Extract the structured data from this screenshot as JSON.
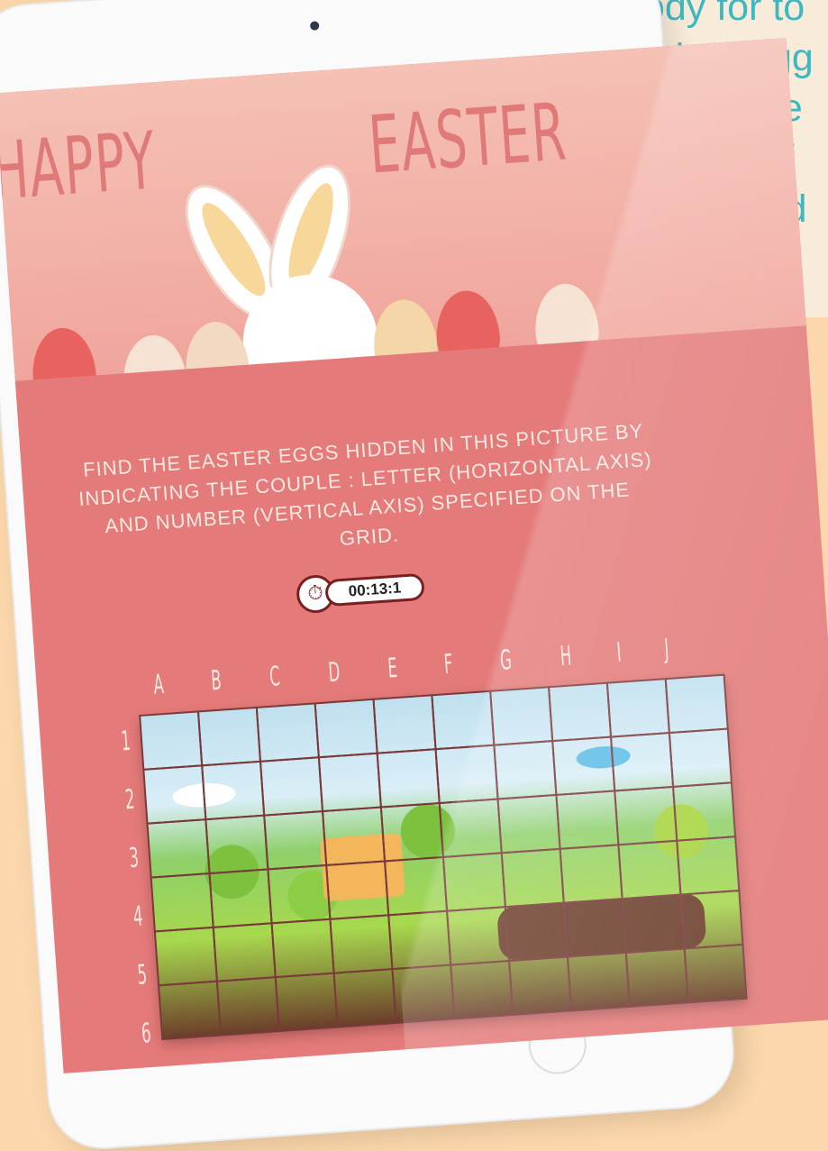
{
  "side_text": {
    "lines": "body for to\nfind an egg\nthe picture\namount of\nyour brand"
  },
  "game": {
    "title_left": "HAPPY",
    "title_right": "EASTER",
    "instructions": "Find the Easter eggs hidden in this picture by indicating the couple : letter (horizontal axis) and number (vertical axis) specified on the grid.",
    "timer_value": "00:13:1",
    "timer_icon": "stopwatch-icon",
    "columns": [
      "A",
      "B",
      "C",
      "D",
      "E",
      "F",
      "G",
      "H",
      "I",
      "J"
    ],
    "rows": [
      "1",
      "2",
      "3",
      "4",
      "5",
      "6"
    ]
  },
  "colors": {
    "screen_bg": "#e47a79",
    "accent_text": "#3ab9c1",
    "page_bg": "#fbd7ab"
  }
}
